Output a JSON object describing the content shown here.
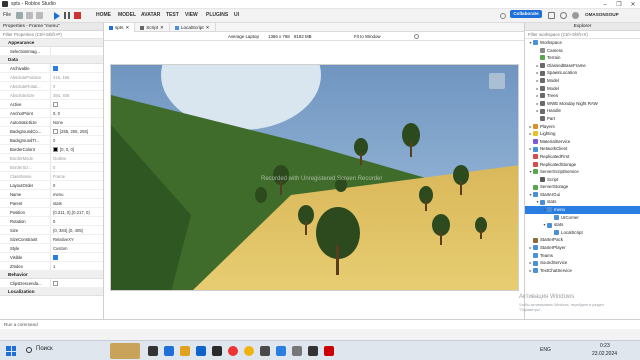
{
  "window": {
    "title": "spts - Roblox Studio",
    "controls": [
      "–",
      "❐",
      "✕"
    ]
  },
  "menu": {
    "items": [
      "HOME",
      "MODEL",
      "AVATAR",
      "TEST",
      "VIEW",
      "PLUGINS",
      "UI"
    ],
    "file": "File"
  },
  "account": {
    "collaborate": "Collaborate",
    "user": "OMASONSOUP"
  },
  "properties": {
    "title": "Properties - Frame \"menu\"",
    "filter_placeholder": "Filter Properties (Ctrl+Shift+P)",
    "sections": {
      "appearance": "Appearance",
      "data": "Data",
      "behavior": "Behavior",
      "localization": "Localization"
    },
    "rows": [
      {
        "k": "SelectionImag...",
        "v": "",
        "dim": false
      },
      {
        "k": "Archivable",
        "v": "",
        "check": true
      },
      {
        "k": "AbsolutePosition",
        "v": "415, 166",
        "dim": true
      },
      {
        "k": "AbsoluteRotati...",
        "v": "0",
        "dim": true
      },
      {
        "k": "AbsoluteSize",
        "v": "384, 405",
        "dim": true
      },
      {
        "k": "Active",
        "v": "",
        "uncheck": true
      },
      {
        "k": "AnchorPoint",
        "v": "0, 0"
      },
      {
        "k": "AutomaticSize",
        "v": "None"
      },
      {
        "k": "BackgroundCo...",
        "v": "[255, 255, 255]",
        "swatch": "#ffffff"
      },
      {
        "k": "BackgroundTr...",
        "v": "0"
      },
      {
        "k": "BorderColor3",
        "v": "[0, 0, 0]",
        "swatch": "#000000"
      },
      {
        "k": "BorderMode",
        "v": "Outline",
        "dim": true
      },
      {
        "k": "BorderSiz...",
        "v": "0",
        "dim": true
      },
      {
        "k": "ClassName",
        "v": "Frame",
        "dim": true
      },
      {
        "k": "LayoutOrder",
        "v": "0"
      },
      {
        "k": "Name",
        "v": "menu"
      },
      {
        "k": "Parent",
        "v": "stats"
      },
      {
        "k": "Position",
        "v": "{0.311, 0},{0.217, 0}"
      },
      {
        "k": "Rotation",
        "v": "0"
      },
      {
        "k": "Size",
        "v": "{0, 384},{0, 405}"
      },
      {
        "k": "SizeConstraint",
        "v": "RelativeXY"
      },
      {
        "k": "Style",
        "v": "Custom"
      },
      {
        "k": "Visible",
        "v": "",
        "check": true
      },
      {
        "k": "ZIndex",
        "v": "1"
      }
    ],
    "behavior_rows": [
      {
        "k": "ClipsDescenda...",
        "v": "",
        "uncheck": true
      }
    ]
  },
  "tabs": [
    {
      "label": "spts",
      "active": true
    },
    {
      "label": "Script",
      "active": false
    },
    {
      "label": "LocalScript",
      "active": false
    }
  ],
  "viewport": {
    "device": "Average Laptop",
    "resolution": "1366 x 768",
    "memory": "8192 MB",
    "fit": "Fit to Window",
    "watermark": "Recorded with Unregistered Screen Recorder"
  },
  "explorer": {
    "title": "Explorer",
    "filter_placeholder": "Filter workspace (Ctrl+Shift+X)",
    "items": [
      {
        "label": "Workspace",
        "depth": 0,
        "arrow": "▾",
        "color": "#4a90d9"
      },
      {
        "label": "Camera",
        "depth": 1,
        "arrow": "",
        "color": "#8a8a8a"
      },
      {
        "label": "Terrain",
        "depth": 1,
        "arrow": "",
        "color": "#5aa64d"
      },
      {
        "label": "GlassedBaseFrame",
        "depth": 1,
        "arrow": "▸",
        "color": "#6a6a6a"
      },
      {
        "label": "SpawnLocation",
        "depth": 1,
        "arrow": "▸",
        "color": "#6a6a6a"
      },
      {
        "label": "Model",
        "depth": 1,
        "arrow": "▸",
        "color": "#6a6a6a"
      },
      {
        "label": "Model",
        "depth": 1,
        "arrow": "▸",
        "color": "#6a6a6a"
      },
      {
        "label": "Trees",
        "depth": 1,
        "arrow": "▸",
        "color": "#6a6a6a"
      },
      {
        "label": "WWE Monday Night RAW",
        "depth": 1,
        "arrow": "▸",
        "color": "#6a6a6a"
      },
      {
        "label": "Handle",
        "depth": 1,
        "arrow": "▸",
        "color": "#6a6a6a"
      },
      {
        "label": "Part",
        "depth": 1,
        "arrow": "",
        "color": "#6a6a6a"
      },
      {
        "label": "Players",
        "depth": 0,
        "arrow": "▸",
        "color": "#d9902a"
      },
      {
        "label": "Lighting",
        "depth": 0,
        "arrow": "▸",
        "color": "#e2c32a"
      },
      {
        "label": "MaterialService",
        "depth": 0,
        "arrow": "",
        "color": "#7a5ad9"
      },
      {
        "label": "NetworkClient",
        "depth": 0,
        "arrow": "▸",
        "color": "#4a90d9"
      },
      {
        "label": "ReplicatedFirst",
        "depth": 0,
        "arrow": "",
        "color": "#d94a4a"
      },
      {
        "label": "ReplicatedStorage",
        "depth": 0,
        "arrow": "",
        "color": "#d94a4a"
      },
      {
        "label": "ServerScriptService",
        "depth": 0,
        "arrow": "▾",
        "color": "#5aa64d"
      },
      {
        "label": "Script",
        "depth": 1,
        "arrow": "",
        "color": "#5a5a5a"
      },
      {
        "label": "ServerStorage",
        "depth": 0,
        "arrow": "",
        "color": "#5aa64d"
      },
      {
        "label": "StarterGui",
        "depth": 0,
        "arrow": "▾",
        "color": "#4a90d9"
      },
      {
        "label": "stats",
        "depth": 1,
        "arrow": "▾",
        "color": "#4a90d9"
      },
      {
        "label": "menu",
        "depth": 2,
        "arrow": "▾",
        "color": "#4a90d9",
        "selected": true
      },
      {
        "label": "UICorner",
        "depth": 3,
        "arrow": "",
        "color": "#4a90d9"
      },
      {
        "label": "stats",
        "depth": 2,
        "arrow": "▾",
        "color": "#4a90d9"
      },
      {
        "label": "LocalScript",
        "depth": 3,
        "arrow": "",
        "color": "#4a90d9"
      },
      {
        "label": "StarterPack",
        "depth": 0,
        "arrow": "",
        "color": "#8a6a3a"
      },
      {
        "label": "StarterPlayer",
        "depth": 0,
        "arrow": "▸",
        "color": "#4a90d9"
      },
      {
        "label": "Teams",
        "depth": 0,
        "arrow": "",
        "color": "#4a90d9"
      },
      {
        "label": "SoundService",
        "depth": 0,
        "arrow": "▸",
        "color": "#4a90d9"
      },
      {
        "label": "TextChatService",
        "depth": 0,
        "arrow": "▸",
        "color": "#4a90d9"
      }
    ],
    "activation_lines": [
      "Активация Windows",
      "Чтобы активировать Windows, перейдите в раздел",
      "\"Параметры\"."
    ]
  },
  "command": {
    "placeholder": "Run a command"
  },
  "taskbar": {
    "search": "Поиск",
    "lang": "ENG",
    "time": "0:23",
    "date": "23.02.2024"
  }
}
